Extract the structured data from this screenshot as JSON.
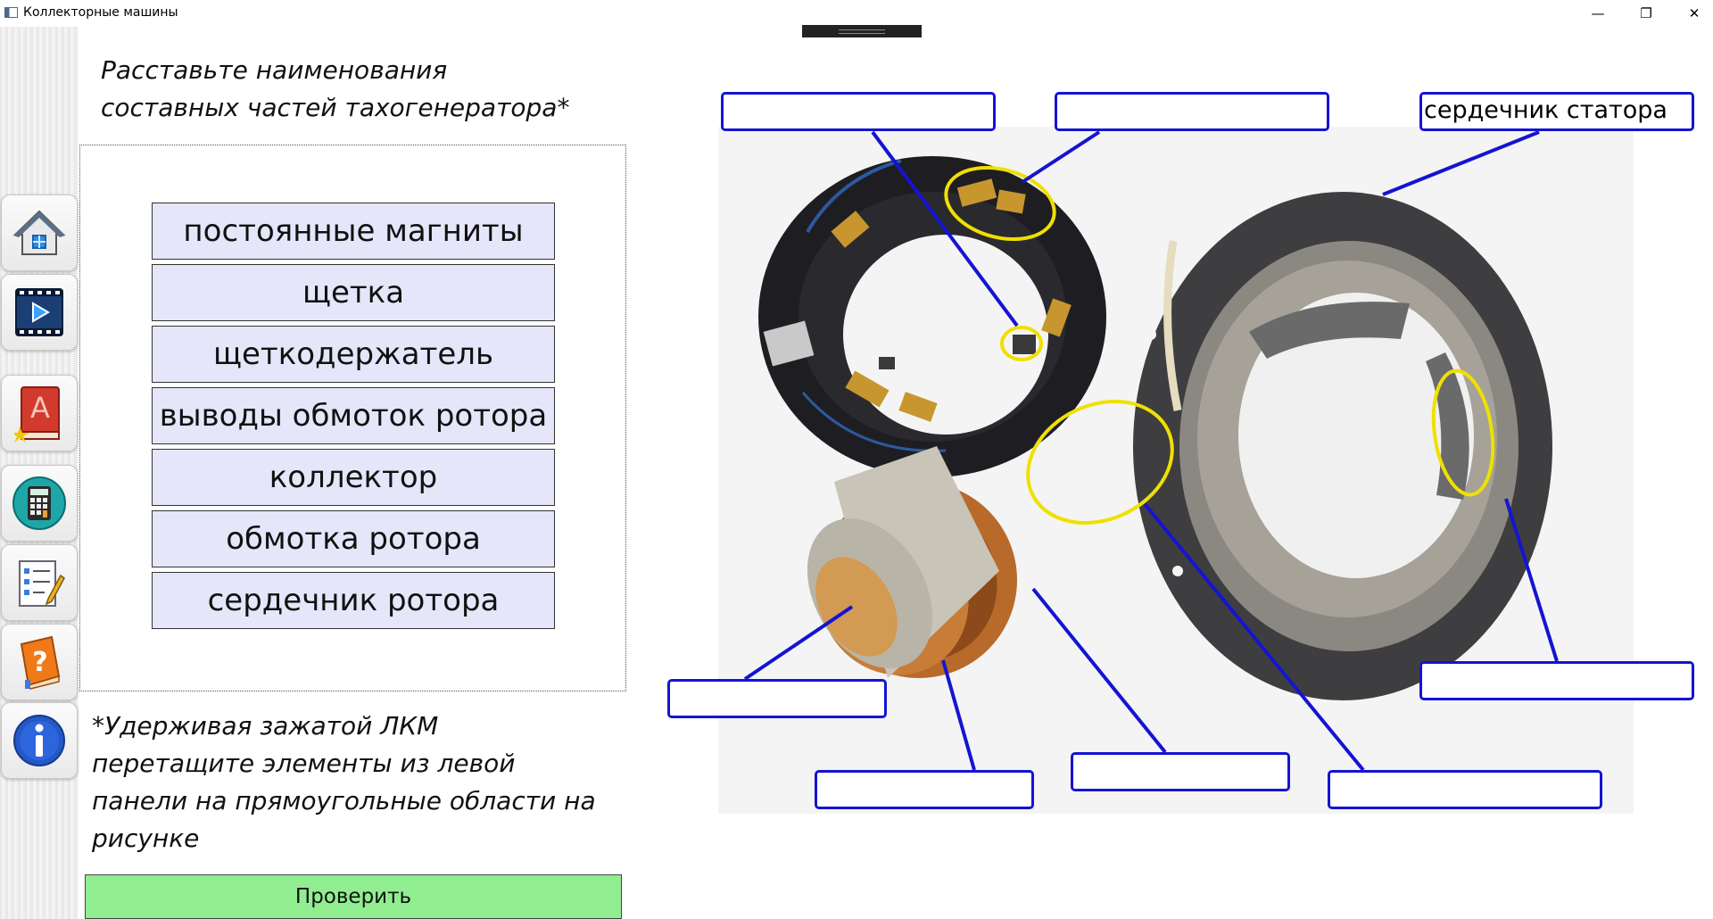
{
  "window": {
    "title": "Коллекторные машины",
    "minimize": "—",
    "restore": "❐",
    "close": "✕"
  },
  "toolbar": {
    "buttons": [
      {
        "name": "home-icon",
        "label": "home"
      },
      {
        "name": "video-icon",
        "label": "video"
      },
      {
        "name": "book-icon",
        "label": "book"
      },
      {
        "name": "calculator-icon",
        "label": "calculator"
      },
      {
        "name": "test-icon",
        "label": "test"
      },
      {
        "name": "help-icon",
        "label": "help"
      },
      {
        "name": "info-icon",
        "label": "info"
      }
    ]
  },
  "instruction": {
    "heading": "Расставьте наименования\nсоставных частей тахогенератора*",
    "footnote": "*Удерживая зажатой ЛКМ\nперетащите элементы из левой\nпанели на прямоугольные области на\nрисунке"
  },
  "items": [
    "постоянные магниты",
    "щетка",
    "щеткодержатель",
    "выводы обмоток ротора",
    "коллектор",
    "обмотка ротора",
    "сердечник ротора"
  ],
  "check_button": "Проверить",
  "drop_zones": {
    "top_left": "",
    "top_middle": "",
    "top_right": "сердечник статора",
    "right_middle": "",
    "bottom_left": "",
    "bottom_1": "",
    "bottom_2": "",
    "bottom_3": ""
  },
  "colors": {
    "drop_border": "#1414d2",
    "highlight": "#f0e000",
    "item_bg": "#e6e6fa",
    "check_bg": "#90ee90"
  }
}
